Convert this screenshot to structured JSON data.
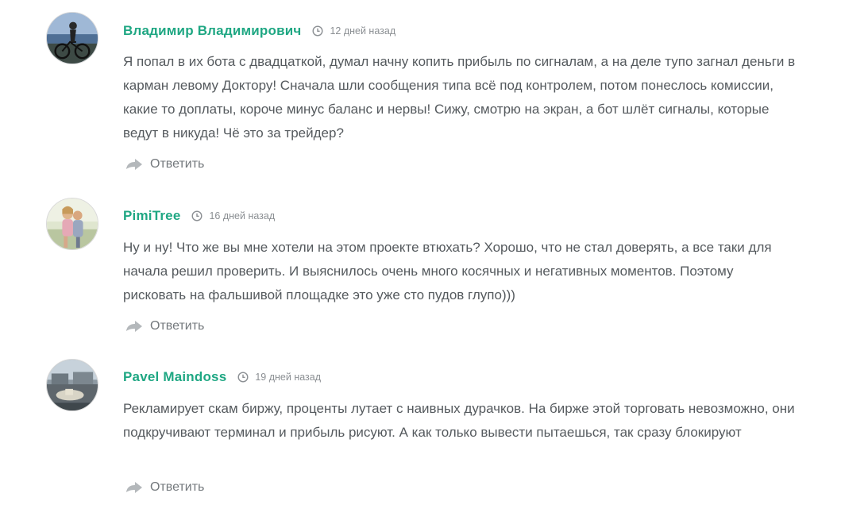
{
  "icons": {
    "clock": "clock-icon",
    "reply": "reply-arrow-icon"
  },
  "colors": {
    "author": "#1fa783",
    "text": "#555a5e",
    "meta": "#8b8f93",
    "icon": "#b4b8bb"
  },
  "comments": [
    {
      "author": "Владимир Владимирович",
      "time": "12 дней назад",
      "text": "Я попал в их бота с двадцаткой, думал начну копить прибыль по сигналам, а на деле тупо загнал деньги в карман левому Доктору! Сначала шли сообщения типа всё под контролем, потом понеслось комиссии, какие то доплаты, короче минус баланс и нервы! Сижу, смотрю на экран, а бот шлёт сигналы, которые ведут в никуда! Чё это за трейдер?",
      "reply_label": "Ответить"
    },
    {
      "author": "PimiTree",
      "time": "16 дней назад",
      "text": "Ну и ну! Что же вы мне хотели на этом проекте втюхать? Хорошо, что не стал доверять, а все таки для начала решил проверить. И выяснилось очень много косячных и негативных моментов. Поэтому рисковать на фальшивой площадке это уже сто пудов глупо)))",
      "reply_label": "Ответить"
    },
    {
      "author": "Pavel Maindoss",
      "time": "19 дней назад",
      "text": "Рекламирует скам биржу, проценты лутает с наивных дурачков. На бирже этой торговать невозможно, они подкручивают терминал и прибыль рисуют. А как только вывести пытаешься, так сразу блокируют",
      "reply_label": "Ответить"
    }
  ]
}
